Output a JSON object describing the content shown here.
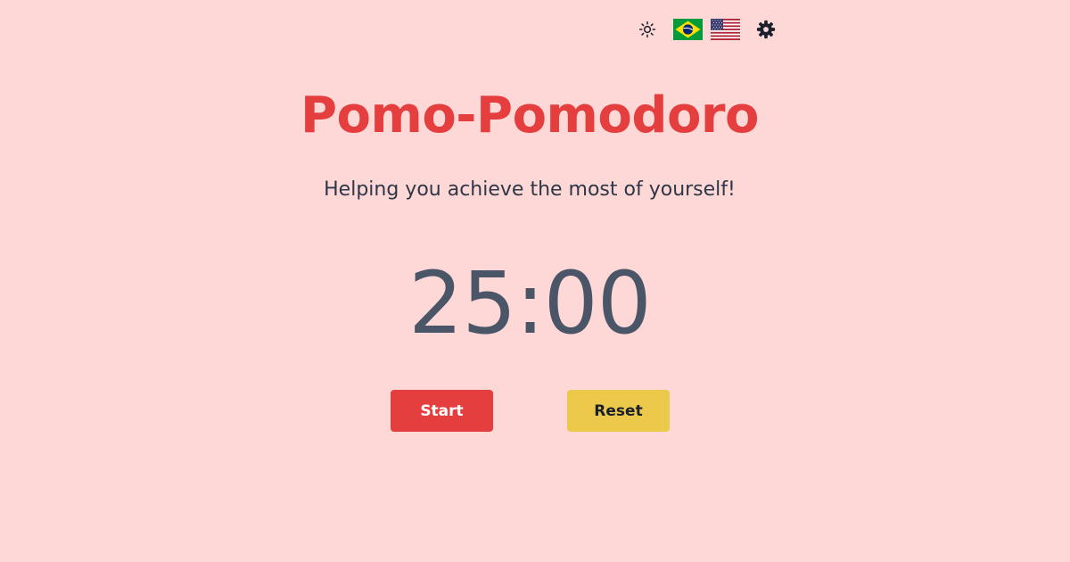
{
  "header": {
    "icons": [
      {
        "name": "sun-icon",
        "purpose": "toggle theme"
      },
      {
        "name": "brazil-flag-icon",
        "purpose": "Portuguese language"
      },
      {
        "name": "usa-flag-icon",
        "purpose": "English language"
      },
      {
        "name": "gear-icon",
        "purpose": "settings"
      }
    ]
  },
  "main": {
    "title": "Pomo-Pomodoro",
    "subtitle": "Helping you achieve the most of yourself!",
    "timer": "25:00"
  },
  "actions": {
    "start_label": "Start",
    "reset_label": "Reset"
  },
  "colors": {
    "background": "#fed7d7",
    "title": "#e53e3e",
    "subtitle": "#2d3748",
    "timer": "#4a5568",
    "start_button": "#e53e3e",
    "reset_button": "#ecc94b"
  }
}
